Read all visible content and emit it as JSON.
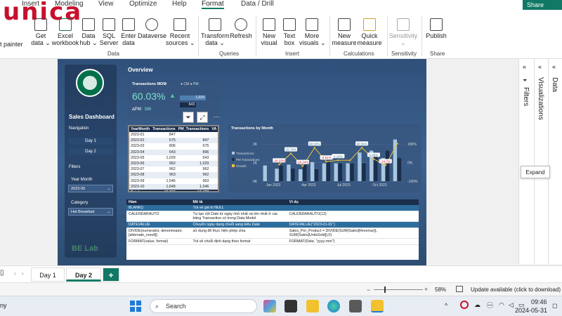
{
  "ribbon": {
    "tabs": [
      "Insert",
      "Modeling",
      "View",
      "Optimize",
      "Help",
      "Format",
      "Data / Drill"
    ],
    "active_tab": "Format",
    "share_label": "Share",
    "brand": "unica",
    "left_cut": "t painter",
    "buttons": [
      {
        "label": "Get\ndata ⌄"
      },
      {
        "label": "Excel\nworkbook"
      },
      {
        "label": "Data\nhub ⌄"
      },
      {
        "label": "SQL\nServer"
      },
      {
        "label": "Enter\ndata"
      },
      {
        "label": "Dataverse"
      },
      {
        "label": "Recent\nsources ⌄"
      },
      {
        "label": "Transform\ndata ⌄"
      },
      {
        "label": "Refresh"
      },
      {
        "label": "New\nvisual"
      },
      {
        "label": "Text\nbox"
      },
      {
        "label": "More\nvisuals ⌄"
      },
      {
        "label": "New\nmeasure"
      },
      {
        "label": "Quick\nmeasure"
      },
      {
        "label": "Sensitivity\n⌄"
      },
      {
        "label": "Publish"
      }
    ],
    "groups": [
      "Data",
      "Queries",
      "Insert",
      "Calculations",
      "Sensitivity",
      "Share"
    ]
  },
  "report": {
    "sidebar": {
      "title": "Sales Dashboard",
      "navigation_label": "Navigation",
      "nav_buttons": [
        "Day 1",
        "Day 2"
      ],
      "filters_label": "Filters",
      "year_month_label": "Year Month",
      "year_month_value": "2023-05",
      "category_label": "Category",
      "category_value": "Hot Breakfast"
    },
    "overview_title": "Overview",
    "kpi": {
      "title": "Transactions MOM",
      "legend": "● CM  ● PM",
      "value": "60.03%",
      "arrow": "▲",
      "bar1_label": "1,029",
      "bar2_label": "643",
      "pm_label": "∆PM:",
      "pm_value": "386"
    },
    "table": {
      "headers": [
        "YearMonth",
        "Transactions",
        "PM_Transactions",
        "VA"
      ],
      "rows": [
        [
          "2023-01",
          "847",
          ""
        ],
        [
          "2023-02",
          "675",
          "847"
        ],
        [
          "2023-03",
          "896",
          "675"
        ],
        [
          "2023-04",
          "643",
          "896"
        ],
        [
          "2023-05",
          "1,029",
          "643"
        ],
        [
          "2023-06",
          "962",
          "1,029"
        ],
        [
          "2023-07",
          "962",
          "962"
        ],
        [
          "2023-08",
          "963",
          "962"
        ],
        [
          "2023-09",
          "1,546",
          "963"
        ],
        [
          "2023-10",
          "1,649",
          "1,546"
        ]
      ],
      "total": [
        "Total",
        "12,950",
        "12,427"
      ]
    },
    "chart_title": "Transactions by Month",
    "desc_table": {
      "headers": [
        "Hàm",
        "Mô tả",
        "Ví dụ"
      ],
      "rows": [
        [
          "BLANK()",
          "Trả về giá trị NULL",
          ""
        ],
        [
          "CALENDARAUTO",
          "Tự tạo cột Date từ ngày nhỏ nhất và lớn nhất ở các bảng Transaction có trong Data Model",
          "CALENDARAUTO(12)"
        ],
        [
          "DATEVALUE",
          "Chuyển ngày dạng chuỗi sang kiểu Date",
          "DATEVALUE(\"2023-01-01\")"
        ],
        [
          "DIVIDE(numerator, denominator, [alternate_result])",
          "sử dụng để thực hiện phép chia",
          "Sales_Per_Product = DIVIDE(SUM(Sales[Revenue]), SUM(Sales[UnitsSold]),0)"
        ],
        [
          "FORMAT(value, format)",
          "Trả về chuỗi định dạng theo format",
          "FORMAT(Date, \"yyyy-mm\")"
        ]
      ]
    },
    "watermark": "BE Lab"
  },
  "chart_data": {
    "type": "bar",
    "title": "Transactions by Month",
    "legend": [
      "Transactions",
      "PM Transactions",
      "Growth"
    ],
    "x_tick_labels": [
      "Jan 2023",
      "Apr 2023",
      "Jul 2023",
      "Oct 2023"
    ],
    "y_left_ticks": [
      "0K",
      "1K",
      "2K"
    ],
    "y_right_ticks": [
      "-100%",
      "0%",
      "100%"
    ],
    "ylim": [
      0,
      2500
    ],
    "categories": [
      "2023-01",
      "2023-02",
      "2023-03",
      "2023-04",
      "2023-05",
      "2023-06",
      "2023-07",
      "2023-08",
      "2023-09",
      "2023-10",
      "2023-11",
      "2023-12"
    ],
    "series": [
      {
        "name": "Transactions",
        "values": [
          847,
          675,
          896,
          643,
          1029,
          962,
          962,
          963,
          1546,
          1649,
          1250,
          2250
        ]
      },
      {
        "name": "PM Transactions",
        "values": [
          0,
          847,
          675,
          896,
          643,
          1029,
          962,
          962,
          963,
          1546,
          1649,
          1250
        ]
      },
      {
        "name": "Growth",
        "values": [
          null,
          -20.33,
          32.74,
          -28.24,
          60.03,
          -6.51,
          0,
          0.1,
          60.54,
          6.66,
          -24.2,
          80
        ]
      }
    ],
    "data_labels": [
      "-20.33%",
      "32.74%",
      "-28.24%",
      "60.03%",
      "-6.51%",
      "0.10%",
      "6.66%",
      "60.54%",
      "-24.2%"
    ]
  },
  "right_panes": {
    "filters_label": "Filters",
    "visualizations_label": "Visualizations",
    "data_label": "Data",
    "tooltip": "Expand"
  },
  "pages": [
    "Day 1",
    "Day 2"
  ],
  "active_page": "Day 2",
  "add_page": "+",
  "status": {
    "zoom": "58%",
    "update": "Update available (click to download)"
  },
  "taskbar": {
    "search": "Search",
    "time": "09:46",
    "date": "2024-05-31",
    "left_cut": "ny"
  },
  "colors": {
    "accent": "#117865",
    "report_bg": "#3a5f8c",
    "bar_dark": "#1b2e4b",
    "bar_light": "#a9c7e0",
    "line": "#f2c12e"
  }
}
